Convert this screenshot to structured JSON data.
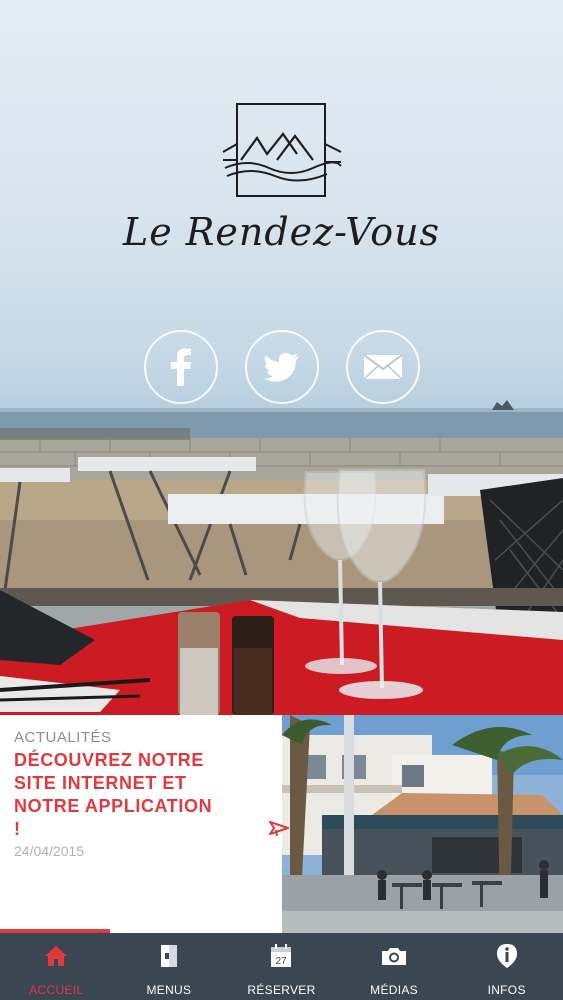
{
  "colors": {
    "accent": "#e0393e",
    "tabbar_bg": "#3a4651",
    "tab_label": "#ffffff",
    "muted_text": "#8e8e8e"
  },
  "brand": {
    "name": "Le Rendez-Vous",
    "logo_icon": "restaurant-logo-icon"
  },
  "social": [
    {
      "name": "facebook",
      "icon": "facebook-icon"
    },
    {
      "name": "twitter",
      "icon": "twitter-icon"
    },
    {
      "name": "email",
      "icon": "mail-icon"
    }
  ],
  "news": {
    "label": "ACTUALITÉS",
    "headline": "DÉCOUVREZ NOTRE SITE INTERNET ET NOTRE APPLICATION !",
    "date": "24/04/2015",
    "arrow_icon": "megaphone-icon"
  },
  "tabs": [
    {
      "label": "ACCUEIL",
      "icon": "home-icon",
      "active": true
    },
    {
      "label": "MENUS",
      "icon": "menu-book-icon",
      "active": false
    },
    {
      "label": "RÉSERVER",
      "icon": "calendar-icon",
      "calendar_day": "27",
      "active": false
    },
    {
      "label": "MÉDIAS",
      "icon": "camera-icon",
      "active": false
    },
    {
      "label": "INFOS",
      "icon": "info-icon",
      "active": false
    }
  ]
}
